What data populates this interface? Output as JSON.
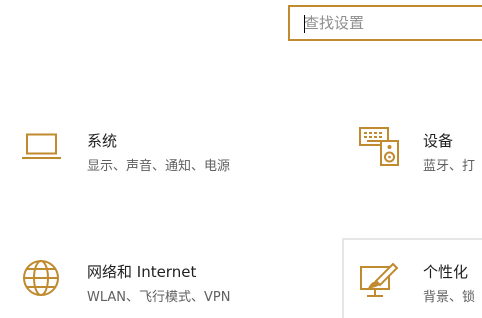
{
  "search": {
    "placeholder": "查找设置"
  },
  "accent_color": "#c08a2e",
  "categories": [
    {
      "title": "系统",
      "subtitle": "显示、声音、通知、电源",
      "icon": "laptop-icon"
    },
    {
      "title": "设备",
      "subtitle": "蓝牙、打",
      "icon": "keyboard-speaker-icon"
    },
    {
      "title": "网络和 Internet",
      "subtitle": "WLAN、飞行模式、VPN",
      "icon": "globe-icon"
    },
    {
      "title": "个性化",
      "subtitle": "背景、锁",
      "icon": "paintbrush-icon"
    }
  ]
}
